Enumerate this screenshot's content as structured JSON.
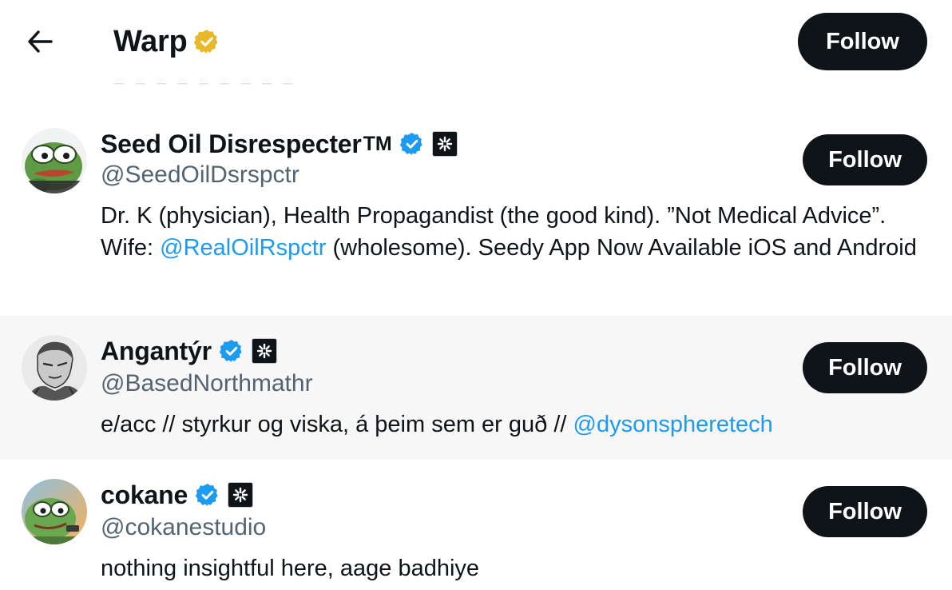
{
  "header": {
    "title": "Warp",
    "follow_label": "Follow",
    "icons": {
      "back": "arrow-left-icon",
      "badge": "gold-verified-badge-icon"
    },
    "badge_color": "#e8b829"
  },
  "colors": {
    "text": "#0f1419",
    "secondary": "#536471",
    "link": "#1d9bf0",
    "verified": "#1d9bf0",
    "button_bg": "#0f1419",
    "button_text": "#ffffff",
    "highlight_row": "#f7f7f7"
  },
  "users": [
    {
      "name": "Seed Oil Disrespecter",
      "name_suffix": "TM",
      "handle": "@SeedOilDsrspctr",
      "bio_before": "Dr. K (physician), Health Propagandist (the good kind). ”Not Medical Advice”. Wife: ",
      "bio_mention": "@RealOilRspctr",
      "bio_after": " (wholesome). Seedy App Now Available iOS and Android",
      "follow_label": "Follow",
      "verified": true,
      "avatar": "pepe-frog-avatar"
    },
    {
      "name": "Angantýr",
      "handle": "@BasedNorthmathr",
      "bio_before": "e/acc // styrkur og viska, á þeim sem er guð // ",
      "bio_mention": "@dysonspheretech",
      "bio_after": "",
      "follow_label": "Follow",
      "verified": true,
      "avatar": "manga-warrior-avatar"
    },
    {
      "name": "cokane",
      "handle": "@cokanestudio",
      "bio_before": "nothing insightful here, aage badhiye",
      "bio_mention": "",
      "bio_after": "",
      "follow_label": "Follow",
      "verified": true,
      "avatar": "pepe-frog-sunset-avatar"
    }
  ]
}
